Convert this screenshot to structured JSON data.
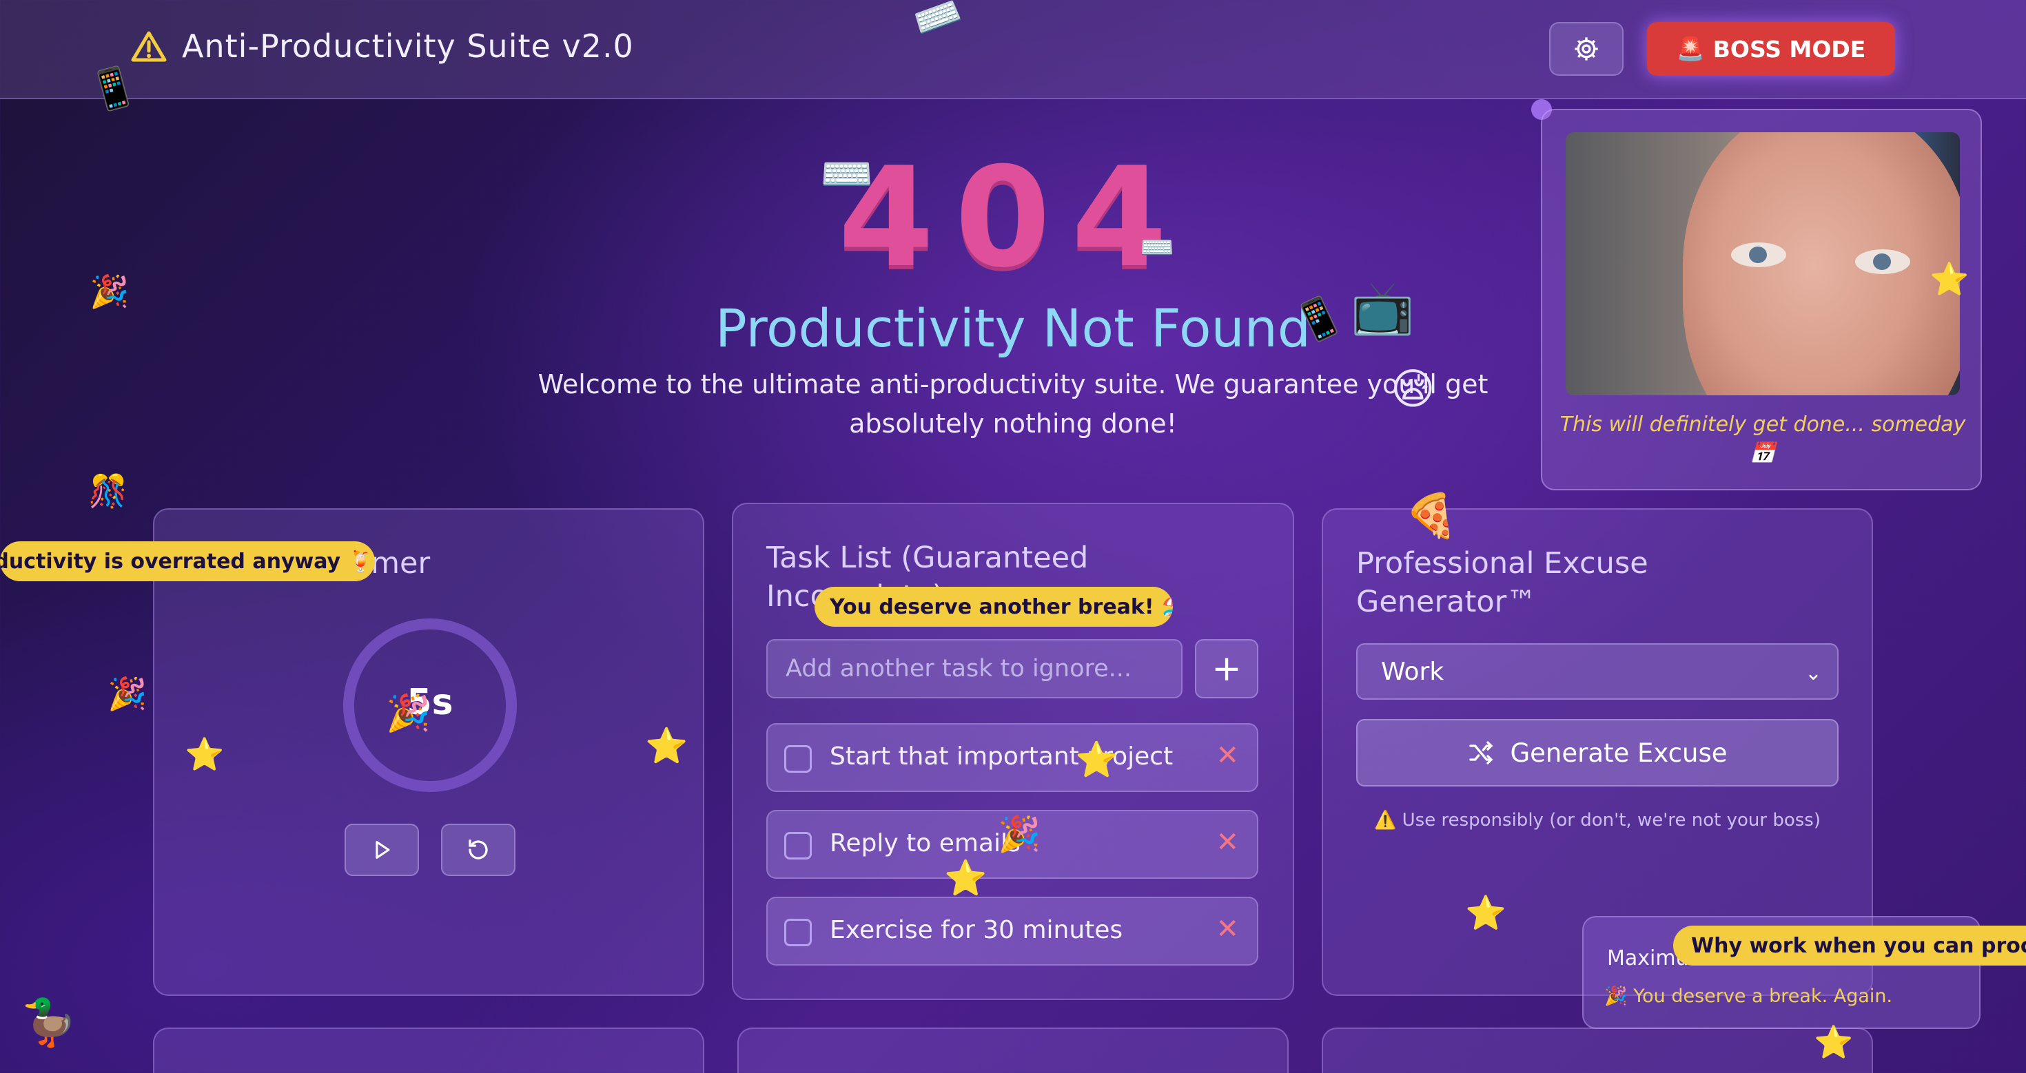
{
  "header": {
    "title": "Anti-Productivity Suite v2.0",
    "boss_mode_label": "BOSS MODE",
    "boss_mode_emoji": "🚨"
  },
  "hero": {
    "code": "404",
    "title": "Productivity Not Found",
    "subtitle": "Welcome to the ultimate anti-productivity suite. We guarantee you'll get absolutely nothing done!"
  },
  "meme": {
    "caption": "This will definitely get done... someday 📅"
  },
  "pomodoro": {
    "title": "Pomodoro Timer",
    "time": "5s"
  },
  "tasks": {
    "title": "Task List (Guaranteed Incomplete)",
    "placeholder": "Add another task to ignore...",
    "add_label": "+",
    "items": [
      {
        "text": "Start that important project"
      },
      {
        "text": "Reply to emails"
      },
      {
        "text": "Exercise for 30 minutes"
      }
    ]
  },
  "excuse": {
    "title": "Professional Excuse Generator™",
    "selected_category": "Work",
    "generate_label": "Generate Excuse",
    "disclaimer": "⚠️ Use responsibly (or don't, we're not your boss)"
  },
  "toasts": {
    "left": "Productivity is overrated anyway 🍹",
    "middle": "You deserve another break! 🏖️",
    "right": "Why work when you can procrastinate?"
  },
  "notification": {
    "title": "Maximum",
    "message": "🎉 You deserve a break. Again."
  },
  "floating_emojis": {
    "phone": "📱",
    "keyboard": "⌨️",
    "tv": "📺",
    "sleepy": "😪",
    "party_popper": "🎉",
    "confetti_ball": "🎊",
    "star": "⭐",
    "pizza": "🍕",
    "duck": "🦆"
  },
  "colors": {
    "accent_pink": "#e0509a",
    "accent_cyan": "#8fd8f5",
    "boss_red": "#d93a3a",
    "toast_yellow": "#f4cc3f"
  }
}
